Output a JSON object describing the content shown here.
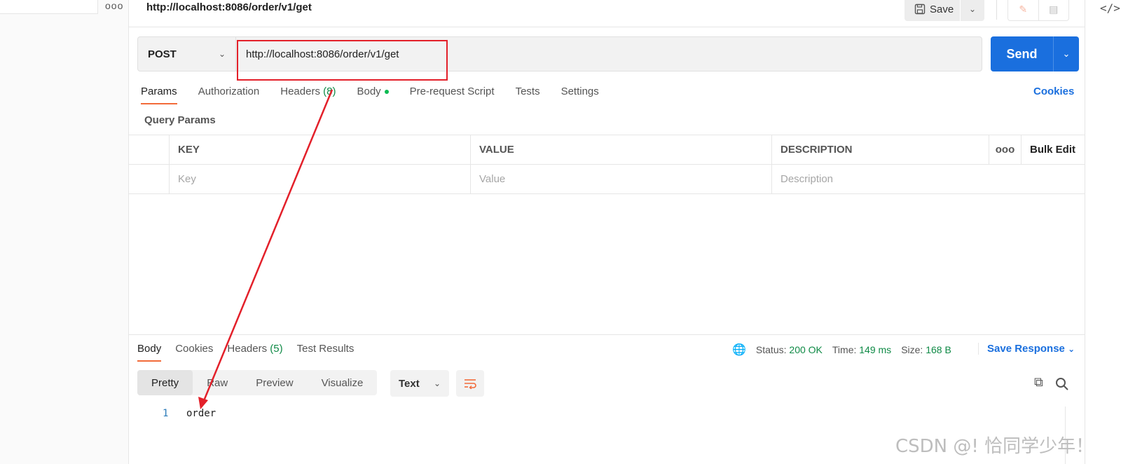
{
  "request": {
    "title": "http://localhost:8086/order/v1/get",
    "save_label": "Save",
    "method": "POST",
    "url": "http://localhost:8086/order/v1/get",
    "send_label": "Send"
  },
  "request_tabs": [
    {
      "label": "Params",
      "active": true
    },
    {
      "label": "Authorization"
    },
    {
      "label": "Headers",
      "count": "(8)"
    },
    {
      "label": "Body",
      "has_dot": true
    },
    {
      "label": "Pre-request Script"
    },
    {
      "label": "Tests"
    },
    {
      "label": "Settings"
    }
  ],
  "cookies_label": "Cookies",
  "query_params": {
    "label": "Query Params",
    "headers": {
      "key": "KEY",
      "value": "VALUE",
      "description": "DESCRIPTION",
      "more": "ooo",
      "bulk_edit": "Bulk Edit"
    },
    "placeholders": {
      "key": "Key",
      "value": "Value",
      "description": "Description"
    }
  },
  "response_tabs": [
    {
      "label": "Body",
      "active": true
    },
    {
      "label": "Cookies"
    },
    {
      "label": "Headers",
      "count": "(5)"
    },
    {
      "label": "Test Results"
    }
  ],
  "response_meta": {
    "status_label": "Status:",
    "status_value": "200 OK",
    "time_label": "Time:",
    "time_value": "149 ms",
    "size_label": "Size:",
    "size_value": "168 B",
    "save_response": "Save Response"
  },
  "view_modes": [
    "Pretty",
    "Raw",
    "Preview",
    "Visualize"
  ],
  "format": "Text",
  "response_body": {
    "line_number": "1",
    "text": "order"
  },
  "watermark": "CSDN @! 恰同学少年！",
  "colors": {
    "accent": "#f26b3a",
    "send": "#1a6fde",
    "annotation": "#e3202a",
    "success": "#0f8a46"
  }
}
